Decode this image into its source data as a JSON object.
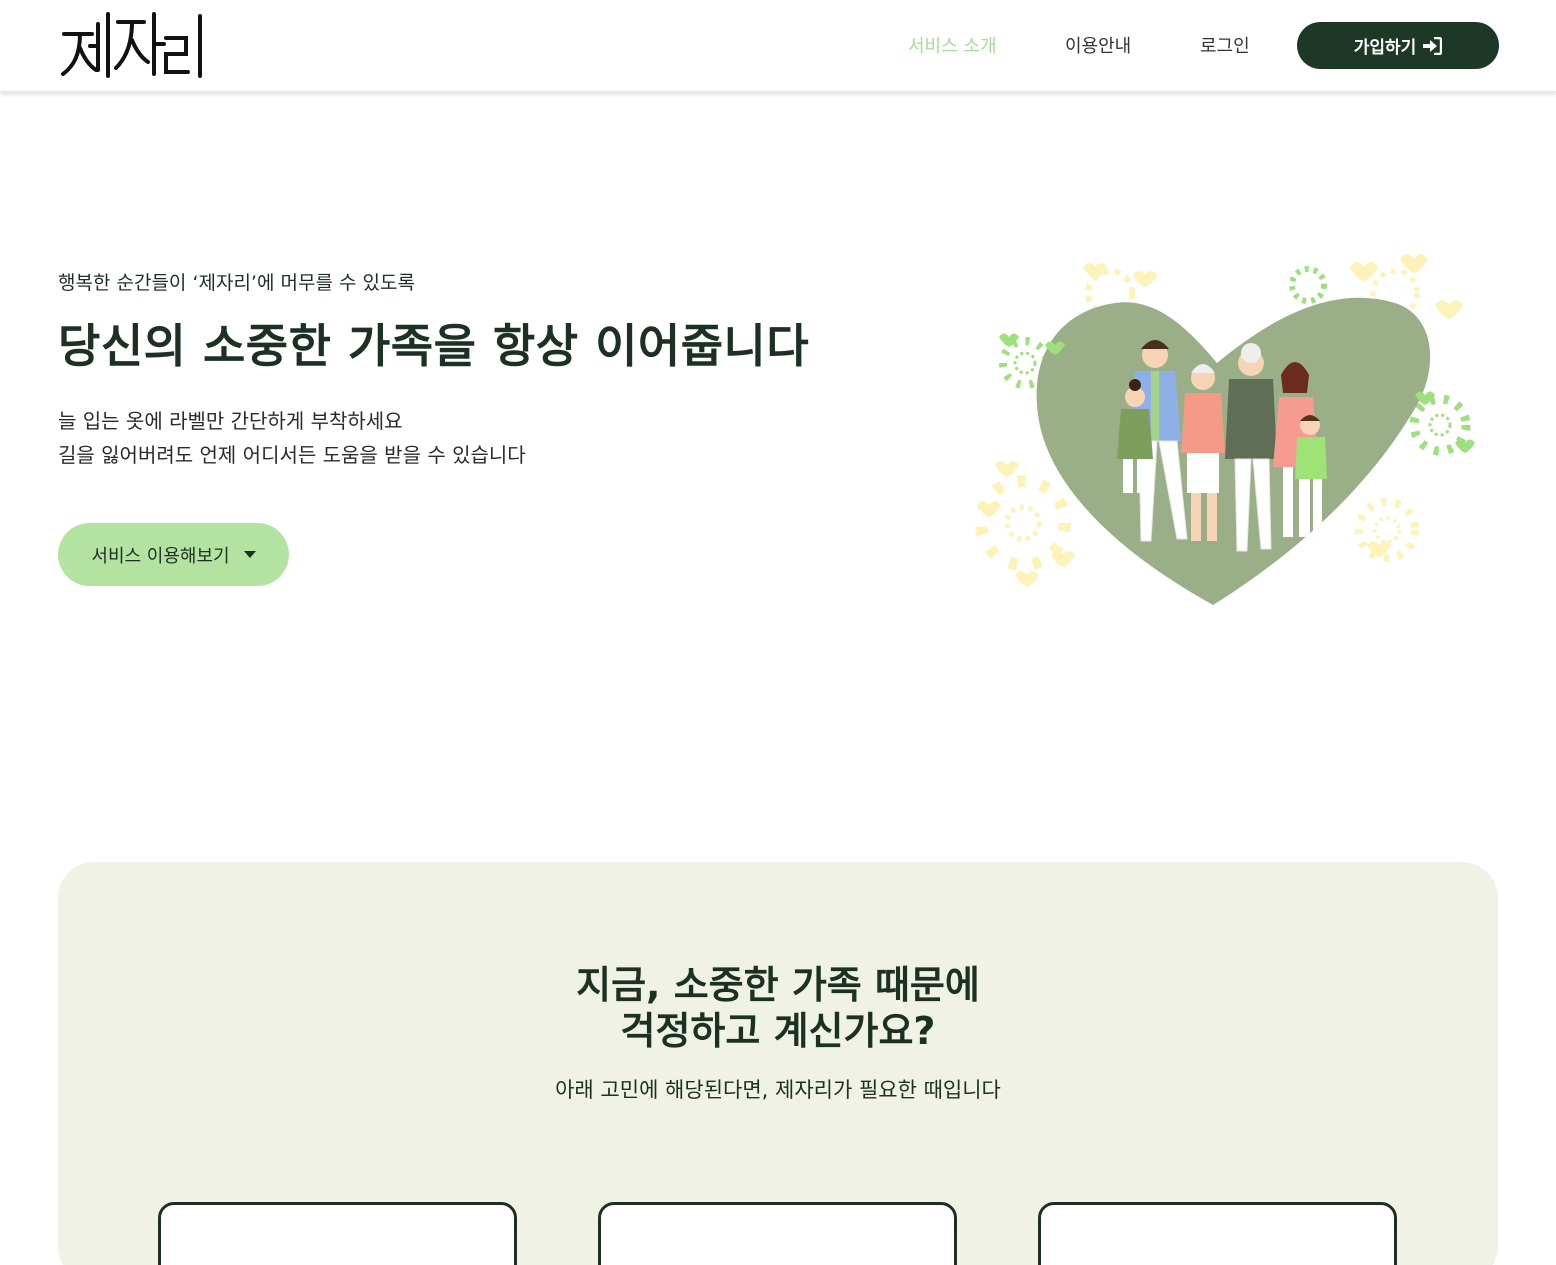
{
  "header": {
    "logo_text": "제자리",
    "nav": [
      {
        "label": "서비스 소개",
        "active": true
      },
      {
        "label": "이용안내",
        "active": false
      },
      {
        "label": "로그인",
        "active": false
      }
    ],
    "signup_label": "가입하기"
  },
  "hero": {
    "eyebrow": "행복한 순간들이 ‘제자리’에 머무를 수 있도록",
    "title": "당신의 소중한 가족을 항상 이어줍니다",
    "desc_line1": "늘 입는 옷에 라벨만 간단하게 부착하세요",
    "desc_line2": "길을 잃어버려도 언제 어디서든 도움을 받을 수 있습니다",
    "cta_label": "서비스 이용해보기"
  },
  "worry": {
    "title_line1": "지금, 소중한 가족 때문에",
    "title_line2": "걱정하고 계신가요?",
    "subtitle": "아래 고민에 해당된다면, 제자리가 필요한 때입니다"
  },
  "colors": {
    "brand_dark": "#1e3828",
    "accent_green": "#a6dc9a",
    "button_light_green": "#b3e2a1",
    "heart_green": "#9aaf87",
    "section_bg": "#f0f2e6"
  },
  "icons": [
    "sign-in-icon",
    "caret-down-icon"
  ]
}
